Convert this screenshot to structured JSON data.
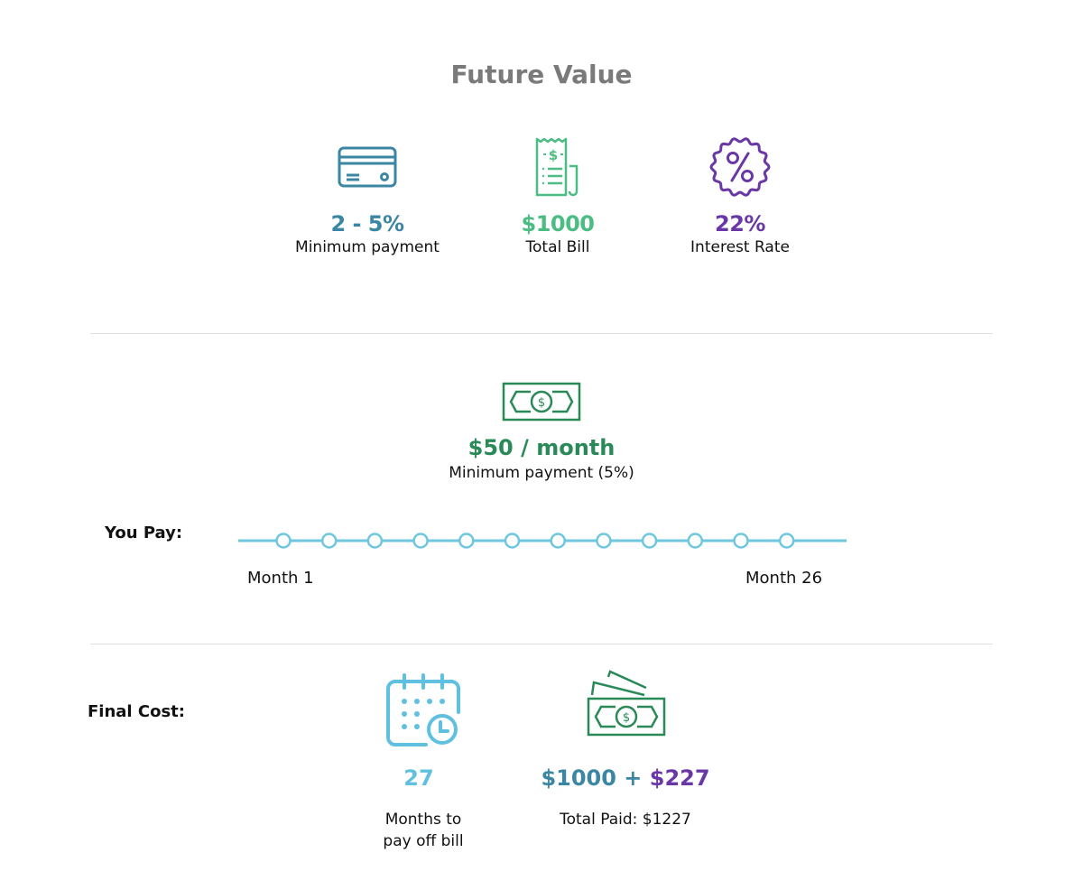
{
  "title": "Future Value",
  "colors": {
    "teal_blue": "#3b87a3",
    "green_light": "#4bbd82",
    "purple": "#6a38a6",
    "green_dark": "#2a8a57",
    "sky": "#5fc0e0",
    "gray_title": "#7a7a7a"
  },
  "inputs": [
    {
      "icon": "credit-card-icon",
      "value": "2 - 5%",
      "label": "Minimum payment"
    },
    {
      "icon": "receipt-icon",
      "value": "$1000",
      "label": "Total Bill"
    },
    {
      "icon": "percent-badge-icon",
      "value": "22%",
      "label": "Interest Rate"
    }
  ],
  "payment": {
    "icon": "banknote-icon",
    "amount": "$50 / month",
    "label": "Minimum payment (5%)"
  },
  "timeline": {
    "row_label": "You Pay:",
    "start_label": "Month 1",
    "end_label": "Month 26",
    "markers": 12
  },
  "final": {
    "row_label": "Final Cost:",
    "months_value": "27",
    "months_label_line1": "Months to",
    "months_label_line2": "pay off bill",
    "principal": "$1000",
    "plus": "+",
    "interest": "$227",
    "total_label": "Total Paid: $1227"
  }
}
